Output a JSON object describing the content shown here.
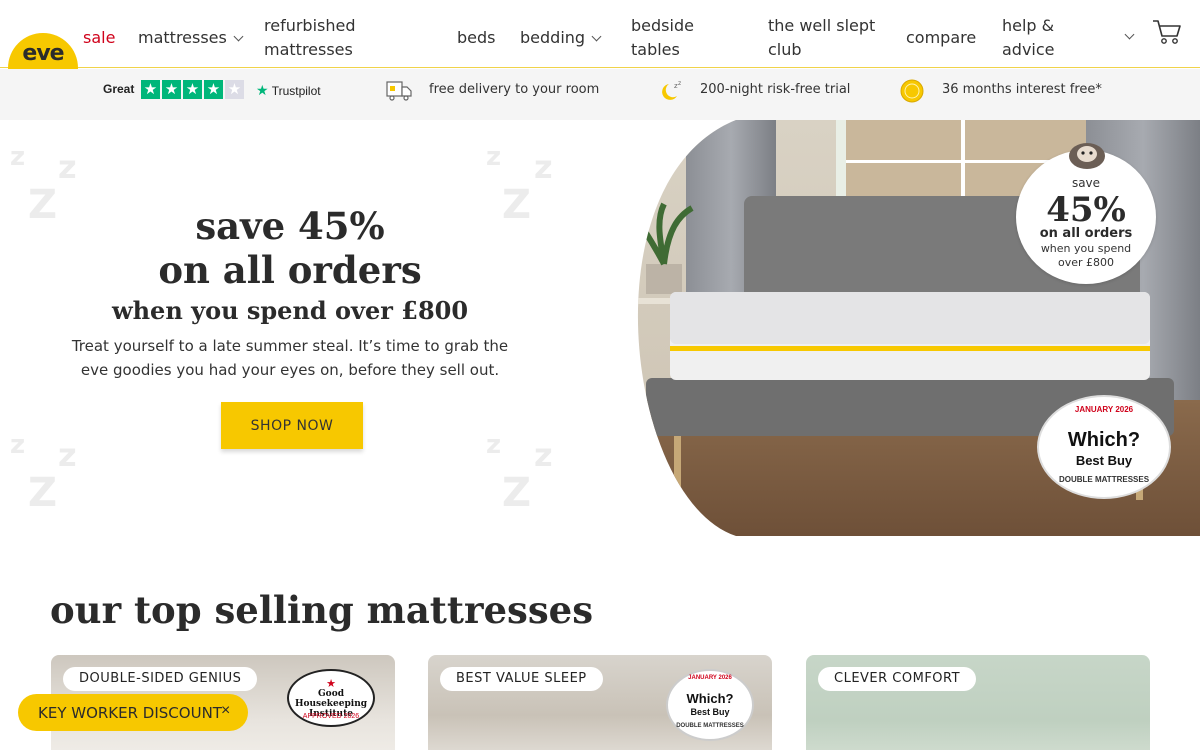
{
  "header": {
    "logo_text": "eve",
    "nav": [
      {
        "label": "sale",
        "dropdown": false
      },
      {
        "label": "mattresses",
        "dropdown": true
      },
      {
        "label_line1": "refurbished",
        "label_line2": "mattresses",
        "dropdown": false
      },
      {
        "label": "beds",
        "dropdown": false
      },
      {
        "label": "bedding",
        "dropdown": true
      },
      {
        "label_line1": "bedside",
        "label_line2": "tables",
        "dropdown": false
      },
      {
        "label_line1": "the well slept",
        "label_line2": "club",
        "dropdown": false
      },
      {
        "label": "compare",
        "dropdown": false
      },
      {
        "label_line1": "help &",
        "label_line2": "advice",
        "dropdown": true
      }
    ],
    "cart_icon": "basket-icon"
  },
  "usp_bar": {
    "trustpilot_rating_label": "Great",
    "trustpilot_stars": 4,
    "trustpilot_brand": "Trustpilot",
    "items": [
      {
        "icon": "delivery-truck-icon",
        "text": "free delivery to your room"
      },
      {
        "icon": "moon-sleep-icon",
        "text": "200-night risk-free trial"
      },
      {
        "icon": "coin-icon",
        "text": "36 months interest free*"
      }
    ]
  },
  "hero": {
    "headline_line1": "save 45%",
    "headline_line2": "on all orders",
    "subheadline": "when you spend over £800",
    "body": "Treat yourself to a late summer steal. It’s time to grab the eve goodies you had your eyes on, before they sell out.",
    "cta": "SHOP NOW",
    "badge": {
      "line1": "save",
      "line2": "45%",
      "line3": "on all orders",
      "line4": "when you spend",
      "line5": "over £800"
    },
    "which_badge": {
      "top": "JANUARY 2026",
      "title": "Which?",
      "subtitle": "Best Buy",
      "bottom": "DOUBLE MATTRESSES"
    }
  },
  "products": {
    "section_title": "our top selling mattresses",
    "cards": [
      {
        "tag": "DOUBLE-SIDED GENIUS",
        "badge": {
          "type": "good-housekeeping",
          "line1": "★",
          "line2": "Good Housekeeping Institute",
          "line3": "APPROVED 2026"
        }
      },
      {
        "tag": "BEST VALUE SLEEP",
        "badge": {
          "type": "which",
          "line1": "JANUARY 2026",
          "line2": "Which?",
          "line3": "Best Buy",
          "line4": "DOUBLE MATTRESSES"
        }
      },
      {
        "tag": "CLEVER COMFORT"
      }
    ]
  },
  "key_worker": {
    "label": "KEY WORKER DISCOUNT",
    "close": "×"
  },
  "colors": {
    "brand_yellow": "#f7c800",
    "sale_red": "#d0021b",
    "trustpilot_green": "#00b67a",
    "text_dark": "#2b2b2b"
  }
}
